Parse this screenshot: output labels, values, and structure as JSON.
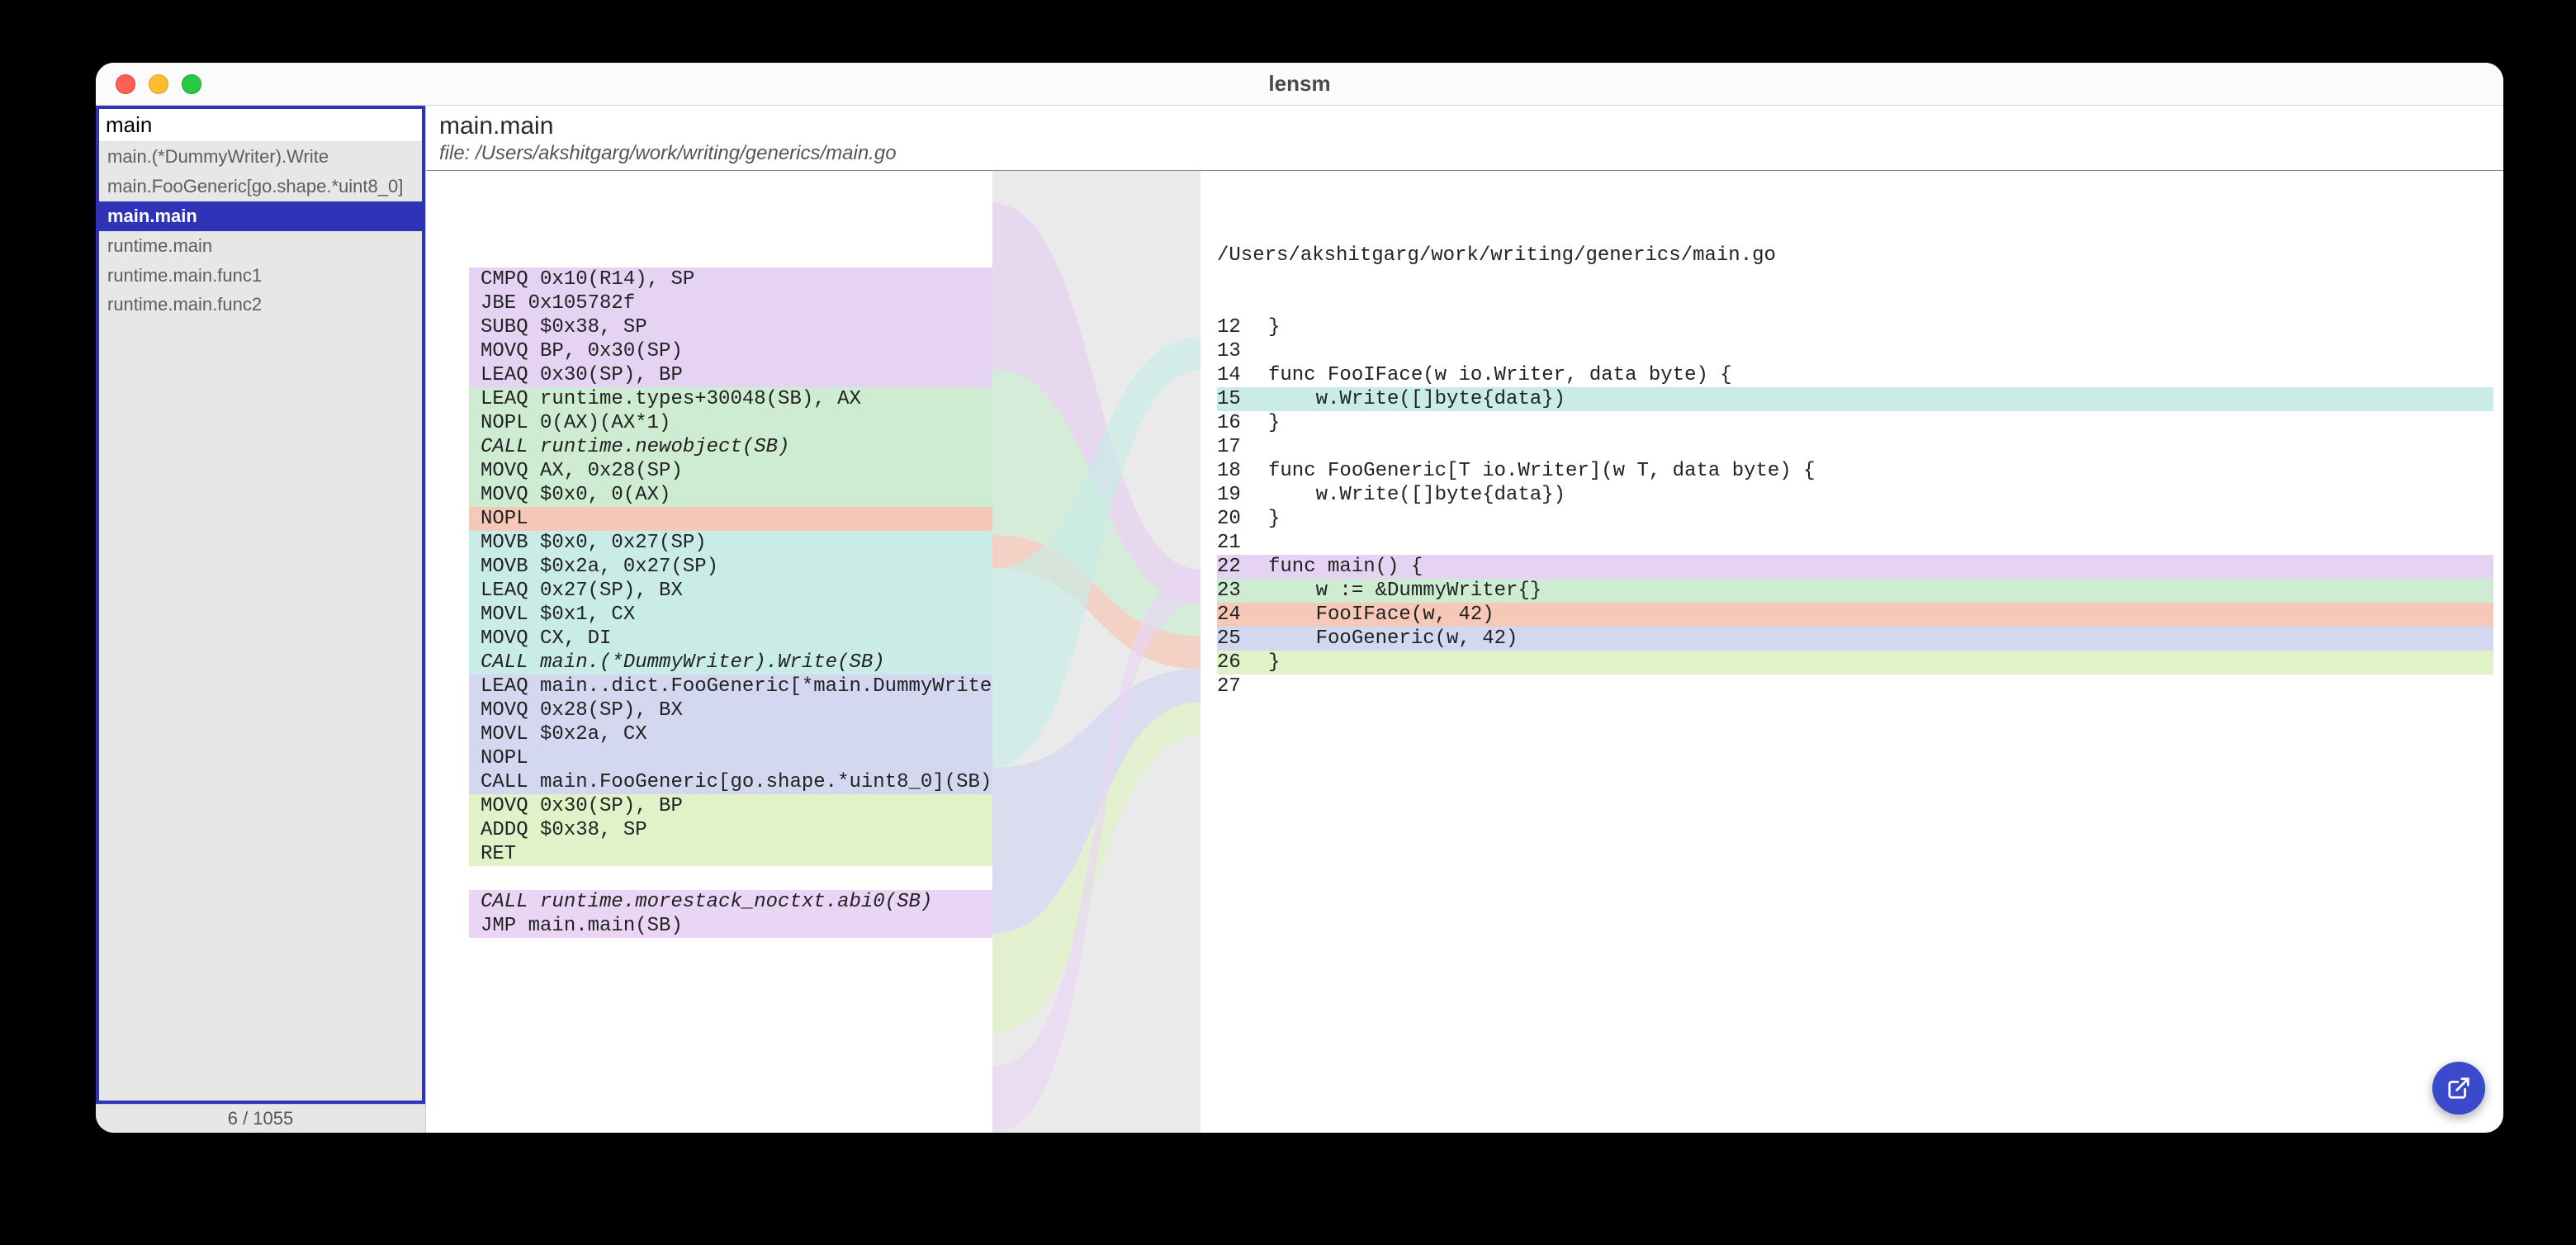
{
  "window": {
    "title": "lensm"
  },
  "sidebar": {
    "search_value": "main",
    "items": [
      {
        "label": "main.(*DummyWriter).Write",
        "selected": false,
        "muted": true
      },
      {
        "label": "main.FooGeneric[go.shape.*uint8_0]",
        "selected": false,
        "muted": true
      },
      {
        "label": "main.main",
        "selected": true,
        "muted": false
      },
      {
        "label": "runtime.main",
        "selected": false,
        "muted": true
      },
      {
        "label": "runtime.main.func1",
        "selected": false,
        "muted": true
      },
      {
        "label": "runtime.main.func2",
        "selected": false,
        "muted": true
      }
    ],
    "status": "6 / 1055"
  },
  "header": {
    "title": "main.main",
    "file_label": "file: /Users/akshitgarg/work/writing/generics/main.go"
  },
  "asm": {
    "groups": [
      {
        "hl": "hl-violet",
        "lines": [
          {
            "text": "CMPQ 0x10(R14), SP"
          },
          {
            "text": "JBE 0x105782f"
          },
          {
            "text": "SUBQ $0x38, SP"
          },
          {
            "text": "MOVQ BP, 0x30(SP)"
          },
          {
            "text": "LEAQ 0x30(SP), BP"
          }
        ]
      },
      {
        "hl": "hl-green",
        "lines": [
          {
            "text": "LEAQ runtime.types+30048(SB), AX"
          },
          {
            "text": "NOPL 0(AX)(AX*1)"
          },
          {
            "text": "CALL runtime.newobject(SB)",
            "italic": true
          },
          {
            "text": "MOVQ AX, 0x28(SP)"
          },
          {
            "text": "MOVQ $0x0, 0(AX)"
          }
        ]
      },
      {
        "hl": "hl-salmon",
        "lines": [
          {
            "text": "NOPL"
          }
        ]
      },
      {
        "hl": "hl-teal",
        "lines": [
          {
            "text": "MOVB $0x0, 0x27(SP)"
          },
          {
            "text": "MOVB $0x2a, 0x27(SP)"
          },
          {
            "text": "LEAQ 0x27(SP), BX"
          },
          {
            "text": "MOVL $0x1, CX"
          },
          {
            "text": "MOVQ CX, DI"
          },
          {
            "text": "CALL main.(*DummyWriter).Write(SB)",
            "italic": true
          }
        ]
      },
      {
        "hl": "hl-blue",
        "lines": [
          {
            "text": "LEAQ main..dict.FooGeneric[*main.DummyWriter]"
          },
          {
            "text": "MOVQ 0x28(SP), BX"
          },
          {
            "text": "MOVL $0x2a, CX"
          },
          {
            "text": "NOPL"
          },
          {
            "text": "CALL main.FooGeneric[go.shape.*uint8_0](SB)"
          }
        ]
      },
      {
        "hl": "hl-lime",
        "lines": [
          {
            "text": "MOVQ 0x30(SP), BP"
          },
          {
            "text": "ADDQ $0x38, SP"
          },
          {
            "text": "RET"
          }
        ]
      },
      {
        "hl": "",
        "lines": [
          {
            "text": " "
          }
        ]
      },
      {
        "hl": "hl-violet2",
        "lines": [
          {
            "text": "CALL runtime.morestack_noctxt.abi0(SB)",
            "italic": true
          },
          {
            "text": "JMP main.main(SB)"
          }
        ]
      }
    ]
  },
  "source": {
    "path": "/Users/akshitgarg/work/writing/generics/main.go",
    "lines": [
      {
        "n": 12,
        "text": "}",
        "hl": ""
      },
      {
        "n": 13,
        "text": "",
        "hl": ""
      },
      {
        "n": 14,
        "text": "func FooIFace(w io.Writer, data byte) {",
        "hl": ""
      },
      {
        "n": 15,
        "text": "    w.Write([]byte{data})",
        "hl": "hl-teal"
      },
      {
        "n": 16,
        "text": "}",
        "hl": ""
      },
      {
        "n": 17,
        "text": "",
        "hl": ""
      },
      {
        "n": 18,
        "text": "func FooGeneric[T io.Writer](w T, data byte) {",
        "hl": ""
      },
      {
        "n": 19,
        "text": "    w.Write([]byte{data})",
        "hl": ""
      },
      {
        "n": 20,
        "text": "}",
        "hl": ""
      },
      {
        "n": 21,
        "text": "",
        "hl": ""
      },
      {
        "n": 22,
        "text": "func main() {",
        "hl": "hl-violet"
      },
      {
        "n": 23,
        "text": "    w := &DummyWriter{}",
        "hl": "hl-green"
      },
      {
        "n": 24,
        "text": "    FooIFace(w, 42)",
        "hl": "hl-salmon"
      },
      {
        "n": 25,
        "text": "    FooGeneric(w, 42)",
        "hl": "hl-blue"
      },
      {
        "n": 26,
        "text": "}",
        "hl": "hl-lime"
      },
      {
        "n": 27,
        "text": "",
        "hl": ""
      }
    ]
  },
  "fab": {
    "icon": "open-external-icon"
  }
}
